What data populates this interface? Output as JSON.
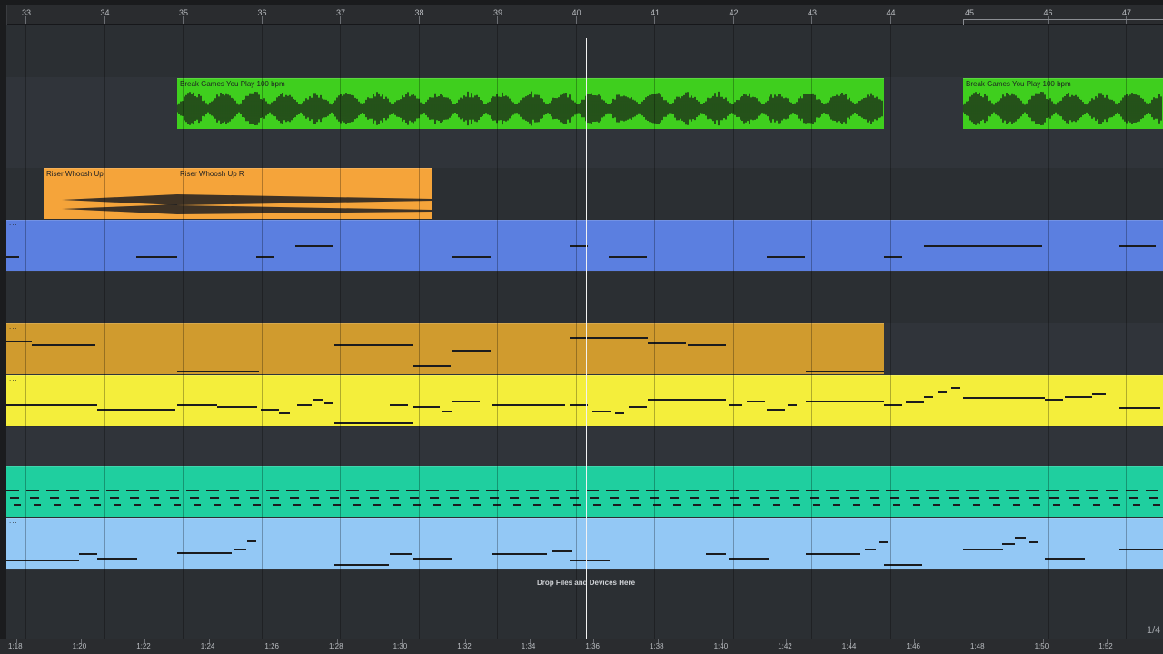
{
  "timeline": {
    "bars": [
      "33",
      "34",
      "35",
      "36",
      "37",
      "38",
      "39",
      "40",
      "41",
      "42",
      "43",
      "44",
      "45",
      "46",
      "47"
    ],
    "times": [
      "1:18",
      "1:20",
      "1:22",
      "1:24",
      "1:26",
      "1:28",
      "1:30",
      "1:32",
      "1:34",
      "1:36",
      "1:38",
      "1:40",
      "1:42",
      "1:44",
      "1:46",
      "1:48",
      "1:50",
      "1:52"
    ],
    "zoom_label": "1/4"
  },
  "clips": {
    "break_1": {
      "title": "Break Games You Play 100 bpm",
      "color": "#3fcf1e"
    },
    "break_2": {
      "title": "Break Games You Play 100 bpm",
      "color": "#3fcf1e"
    },
    "riser_1": {
      "title": "Riser Whoosh Up",
      "color": "#f5a43a"
    },
    "riser_2": {
      "title": "Riser Whoosh Up R",
      "color": "#f5a43a"
    },
    "blue_midi": {
      "color": "#5b7fe0"
    },
    "gold_midi": {
      "color": "#d09b2e"
    },
    "yellow_midi": {
      "color": "#f4ee3b"
    },
    "teal_midi": {
      "color": "#1fcf9f"
    },
    "lightblue_midi": {
      "color": "#93c8f5"
    }
  },
  "drop_hint": "Drop Files and Devices Here"
}
